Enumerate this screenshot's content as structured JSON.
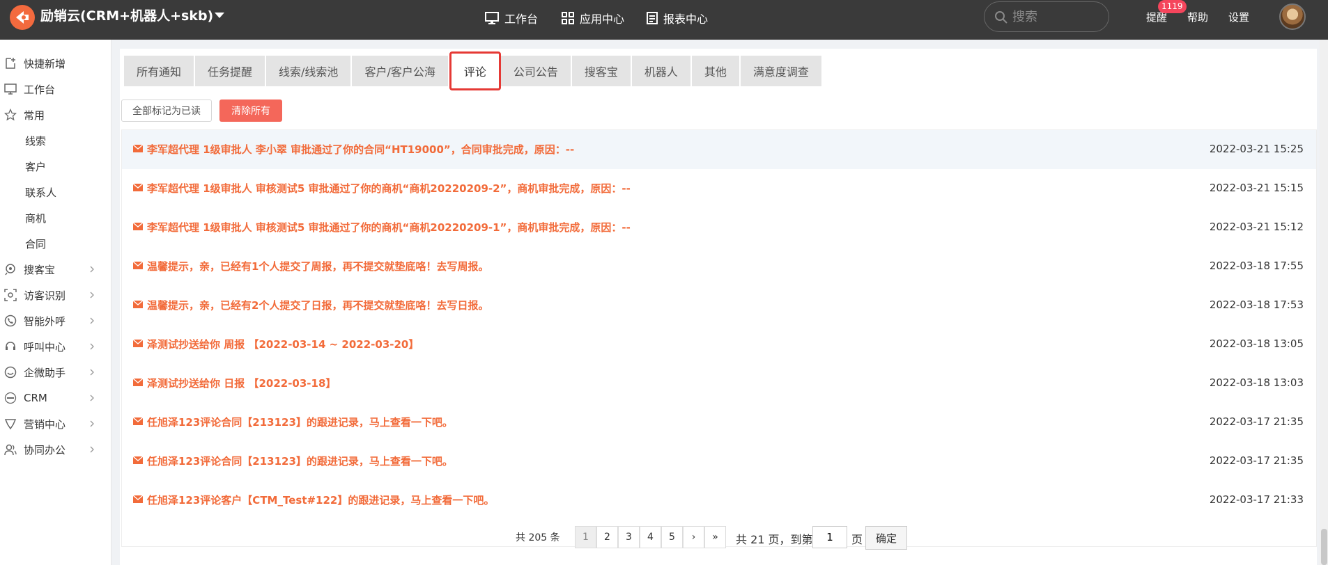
{
  "app": {
    "title": "励销云(CRM+机器人+skb)",
    "logo_icon": "logo-icon",
    "accent": "#f36a3e"
  },
  "topnav": [
    {
      "label": "工作台",
      "icon": "monitor-icon"
    },
    {
      "label": "应用中心",
      "icon": "grid-icon"
    },
    {
      "label": "报表中心",
      "icon": "report-icon"
    }
  ],
  "search": {
    "placeholder": "搜索"
  },
  "topright": {
    "remind_label": "提醒",
    "remind_badge": "1119",
    "help_label": "帮助",
    "settings_label": "设置"
  },
  "sidebar": {
    "items": [
      {
        "label": "快捷新增",
        "icon": "add-doc-icon"
      },
      {
        "label": "工作台",
        "icon": "monitor-icon"
      },
      {
        "label": "常用",
        "icon": "star-icon"
      },
      {
        "label": "线索"
      },
      {
        "label": "客户"
      },
      {
        "label": "联系人"
      },
      {
        "label": "商机"
      },
      {
        "label": "合同"
      },
      {
        "label": "搜客宝",
        "icon": "search-treasure-icon"
      },
      {
        "label": "访客识别",
        "icon": "visitor-icon"
      },
      {
        "label": "智能外呼",
        "icon": "phone-icon"
      },
      {
        "label": "呼叫中心",
        "icon": "call-center-icon"
      },
      {
        "label": "企微助手",
        "icon": "chat-icon"
      },
      {
        "label": "CRM",
        "icon": "crm-icon"
      },
      {
        "label": "营销中心",
        "icon": "marketing-icon"
      },
      {
        "label": "协同办公",
        "icon": "team-icon"
      }
    ]
  },
  "tabs": [
    {
      "label": "所有通知"
    },
    {
      "label": "任务提醒"
    },
    {
      "label": "线索/线索池"
    },
    {
      "label": "客户/客户公海"
    },
    {
      "label": "评论",
      "active": true
    },
    {
      "label": "公司公告"
    },
    {
      "label": "搜客宝"
    },
    {
      "label": "机器人"
    },
    {
      "label": "其他"
    },
    {
      "label": "满意度调查"
    }
  ],
  "actions": {
    "mark_all_label": "全部标记为已读",
    "clear_all_label": "清除所有"
  },
  "notifications": [
    {
      "text": "李军超代理 1级审批人 李小翠 审批通过了你的合同“HT19000”，合同审批完成，原因：--",
      "time": "2022-03-21 15:25"
    },
    {
      "text": "李军超代理 1级审批人 审核测试5 审批通过了你的商机“商机20220209-2”，商机审批完成，原因：--",
      "time": "2022-03-21 15:15"
    },
    {
      "text": "李军超代理 1级审批人 审核测试5 审批通过了你的商机“商机20220209-1”，商机审批完成，原因：--",
      "time": "2022-03-21 15:12"
    },
    {
      "text": "温馨提示，亲，已经有1个人提交了周报，再不提交就垫底咯！去写周报。",
      "time": "2022-03-18 17:55"
    },
    {
      "text": "温馨提示，亲，已经有2个人提交了日报，再不提交就垫底咯！去写日报。",
      "time": "2022-03-18 17:53"
    },
    {
      "text": "泽测试抄送给你 周报 【2022-03-14 ~ 2022-03-20】",
      "time": "2022-03-18 13:05"
    },
    {
      "text": "泽测试抄送给你 日报 【2022-03-18】",
      "time": "2022-03-18 13:03"
    },
    {
      "text": "任旭泽123评论合同【213123】的跟进记录，马上查看一下吧。",
      "time": "2022-03-17 21:35"
    },
    {
      "text": "任旭泽123评论合同【213123】的跟进记录，马上查看一下吧。",
      "time": "2022-03-17 21:35"
    },
    {
      "text": "任旭泽123评论客户【CTM_Test#122】的跟进记录，马上查看一下吧。",
      "time": "2022-03-17 21:33"
    }
  ],
  "pagination": {
    "total_text": "共 205 条",
    "pages": [
      "1",
      "2",
      "3",
      "4",
      "5"
    ],
    "next": "›",
    "last": "»",
    "page_count_text": "共 21 页，到第",
    "goto_value": "1",
    "page_unit": "页",
    "confirm_label": "确定"
  },
  "colors": {
    "notification_text": "#f26b3a",
    "clear_button": "#f4675a",
    "active_tab_border": "#e53935",
    "topbar": "#3a3a3a"
  }
}
